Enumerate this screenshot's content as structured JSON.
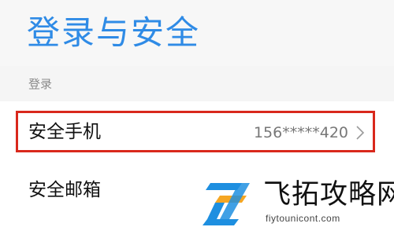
{
  "header": {
    "title": "登录与安全"
  },
  "section": {
    "title": "登录"
  },
  "rows": [
    {
      "label": "安全手机",
      "value": "156*****420",
      "has_chevron": true,
      "highlighted": true
    },
    {
      "label": "安全邮箱"
    }
  ],
  "watermark": {
    "text": "飞拓攻略网",
    "domain": "fiytounicont.com"
  },
  "colors": {
    "title": "#2f8be6",
    "highlight": "#d9281c"
  },
  "icons": {
    "chevron": "chevron-right-icon",
    "logo": "watermark-logo-icon"
  }
}
